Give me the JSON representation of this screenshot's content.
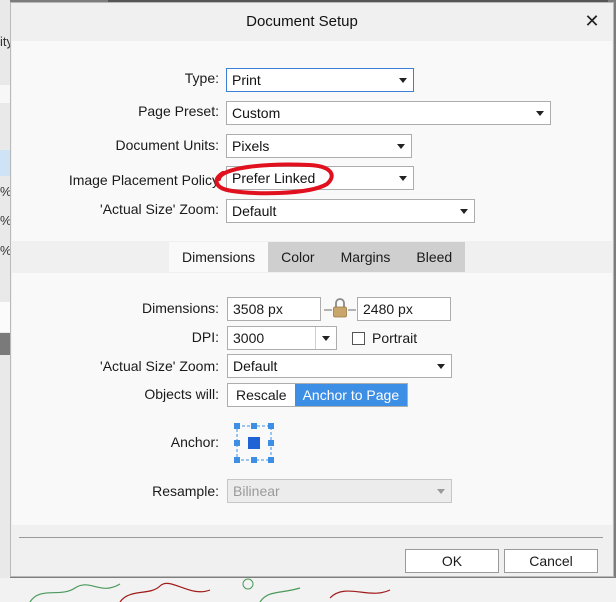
{
  "background": {
    "left_fragments": [
      "ity",
      "%",
      "%",
      "%"
    ]
  },
  "dialog": {
    "title": "Document Setup",
    "close_icon": "close-icon",
    "type": {
      "label": "Type:",
      "value": "Print"
    },
    "page_preset": {
      "label": "Page Preset:",
      "value": "Custom"
    },
    "document_units": {
      "label": "Document Units:",
      "value": "Pixels"
    },
    "image_placement": {
      "label": "Image Placement Policy",
      "value": "Prefer Linked"
    },
    "actual_size_zoom_top": {
      "label": "'Actual Size' Zoom:",
      "value": "Default"
    },
    "tabs": [
      {
        "label": "Dimensions",
        "active": true
      },
      {
        "label": "Color",
        "active": false
      },
      {
        "label": "Margins",
        "active": false
      },
      {
        "label": "Bleed",
        "active": false
      }
    ],
    "dimensions": {
      "label": "Dimensions:",
      "width": "3508 px",
      "height": "2480 px",
      "lock_icon": "lock-icon"
    },
    "dpi": {
      "label": "DPI:",
      "value": "3000"
    },
    "portrait": {
      "label": "Portrait",
      "checked": false
    },
    "actual_size_zoom": {
      "label": "'Actual Size' Zoom:",
      "value": "Default"
    },
    "objects_will": {
      "label": "Objects will:",
      "options": [
        "Rescale",
        "Anchor to Page"
      ],
      "selected": "Anchor to Page"
    },
    "anchor": {
      "label": "Anchor:",
      "selected": "center"
    },
    "resample": {
      "label": "Resample:",
      "value": "Bilinear",
      "disabled": true
    },
    "ok_label": "OK",
    "cancel_label": "Cancel"
  },
  "colors": {
    "accent": "#3d8ee5",
    "annotation": "#e0101e",
    "lock": "#c8a56a"
  }
}
